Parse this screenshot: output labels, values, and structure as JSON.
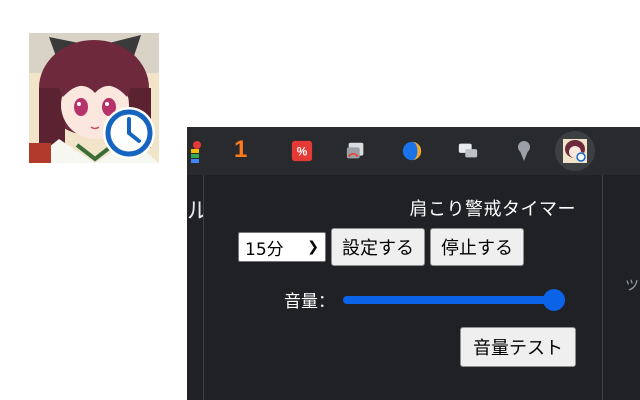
{
  "extension_icon": {
    "name": "anime-girl-timer-icon"
  },
  "toolbar": {
    "icons": [
      "colored-dots-icon",
      "orange-badge-icon",
      "red-tag-icon",
      "window-cast-icon",
      "moon-icon",
      "chat-icon",
      "map-pin-icon",
      "extension-avatar-icon"
    ],
    "badge_text": "1"
  },
  "page_fragments": {
    "left": "ル",
    "right": "ツ"
  },
  "popup": {
    "title": "肩こり警戒タイマー",
    "select_value": "15分",
    "set_button": "設定する",
    "stop_button": "停止する",
    "volume_label": "音量：",
    "volume_level": 1.0,
    "test_button": "音量テスト"
  },
  "colors": {
    "slider_accent": "#0b63e8",
    "badge_orange": "#ff7a1a",
    "panel_bg": "#202124"
  }
}
